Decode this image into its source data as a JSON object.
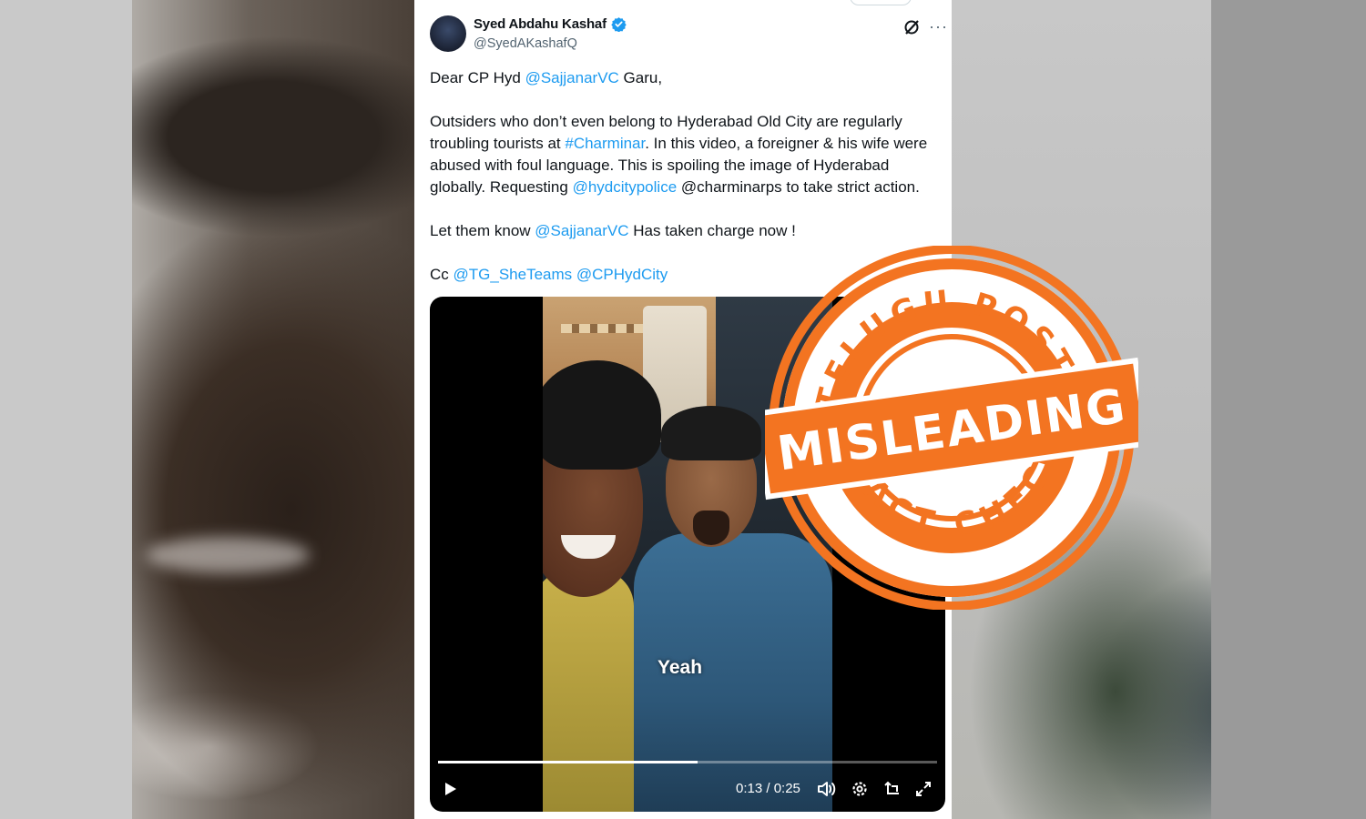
{
  "tweet": {
    "display_name": "Syed Abdahu Kashaf",
    "handle": "@SyedAKashafQ",
    "verified_icon": "verified-badge-icon",
    "body": {
      "line1_prefix": "Dear CP Hyd ",
      "line1_mention": "@SajjanarVC",
      "line1_suffix": " Garu,",
      "p2_a": "Outsiders who don’t even belong to Hyderabad Old City are regularly troubling tourists at ",
      "p2_hashtag": "#Charminar",
      "p2_b": ". In this video, a foreigner & his wife were abused with foul language. This is spoiling the image of Hyderabad globally. Requesting ",
      "p2_mention": "@hydcitypolice",
      "p2_c": " @charminarps to take strict action.",
      "p3_a": "Let them know ",
      "p3_mention": "@SajjanarVC",
      "p3_b": " Has taken charge now !",
      "p4_a": "Cc ",
      "p4_mention1": "@TG_SheTeams",
      "p4_space": " ",
      "p4_mention2": "@CPHydCity"
    }
  },
  "video": {
    "caption": "Yeah",
    "time_display": "0:13 / 0:25",
    "progress_fraction": 0.52,
    "controls": [
      "play-icon",
      "volume-icon",
      "settings-icon",
      "rotate-icon",
      "fullscreen-icon"
    ]
  },
  "stamp": {
    "top_text": "TELUGU POST",
    "middle_text": "MISLEADING",
    "bottom_text": "FACT CHECK",
    "color": "#f37421"
  },
  "colors": {
    "link": "#1d9bf0",
    "text": "#0f1419",
    "muted": "#536471"
  }
}
